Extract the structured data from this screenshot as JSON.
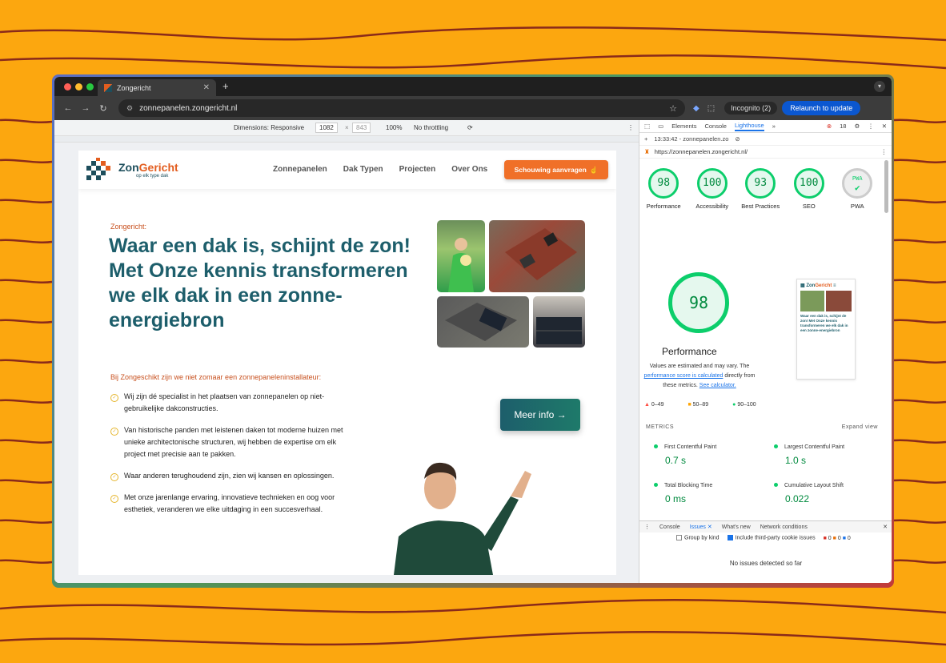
{
  "browser": {
    "tab_title": "Zongericht",
    "url": "zonnepanelen.zongericht.nl",
    "incognito_label": "Incognito (2)",
    "relaunch_label": "Relaunch to update"
  },
  "device_toolbar": {
    "dimensions_label": "Dimensions: Responsive",
    "width": "1082",
    "height": "843",
    "zoom": "100%",
    "throttling": "No throttling"
  },
  "site": {
    "logo_zon": "Zon",
    "logo_gericht": "Gericht",
    "logo_tagline": "op elk type dak",
    "nav": [
      "Zonnepanelen",
      "Dak Typen",
      "Projecten",
      "Over Ons"
    ],
    "cta_label": "Schouwing aanvragen",
    "kicker": "Zongericht:",
    "headline_1": "Waar een dak is, schijnt de zon!",
    "headline_2": "Met Onze kennis transformeren we elk dak in een zonne-energiebron",
    "intro": "Bij Zongeschikt zijn we niet zomaar een zonnepaneleninstallateur:",
    "bullets": [
      "Wij zijn dé specialist in het plaatsen van zonnepanelen op niet-gebruikelijke dakconstructies.",
      "Van historische panden met leistenen daken tot moderne huizen met unieke architectonische structuren, wij hebben de expertise om elk project met precisie aan te pakken.",
      "Waar anderen terughoudend zijn, zien wij kansen en oplossingen.",
      "Met onze jarenlange ervaring, innovatieve technieken en oog voor esthetiek, veranderen we elke uitdaging in een succesverhaal."
    ],
    "meer_info_label": "Meer info →"
  },
  "devtools": {
    "tabs": [
      "Elements",
      "Console",
      "Lighthouse"
    ],
    "error_count": "18",
    "report_time": "13:33:42 - zonnepanelen.zo",
    "report_url": "https://zonnepanelen.zongericht.nl/",
    "scores": [
      {
        "label": "Performance",
        "value": "98"
      },
      {
        "label": "Accessibility",
        "value": "100"
      },
      {
        "label": "Best Practices",
        "value": "93"
      },
      {
        "label": "SEO",
        "value": "100"
      },
      {
        "label": "PWA",
        "value": ""
      }
    ],
    "pwa_badge": "PWA",
    "big_score": "98",
    "big_label": "Performance",
    "note_1": "Values are estimated and may vary. The",
    "note_link_1": "performance score is calculated",
    "note_2": "directly from these metrics.",
    "note_link_2": "See calculator.",
    "legend": [
      "0–49",
      "50–89",
      "90–100"
    ],
    "metrics_title": "METRICS",
    "expand_label": "Expand view",
    "metrics": [
      {
        "name": "First Contentful Paint",
        "value": "0.7 s"
      },
      {
        "name": "Largest Contentful Paint",
        "value": "1.0 s"
      },
      {
        "name": "Total Blocking Time",
        "value": "0 ms"
      },
      {
        "name": "Cumulative Layout Shift",
        "value": "0.022"
      }
    ],
    "drawer_tabs": [
      "Console",
      "Issues",
      "What's new",
      "Network conditions"
    ],
    "group_by_kind": "Group by kind",
    "include_third_party": "Include third-party cookie issues",
    "issue_counts": [
      "0",
      "0",
      "0"
    ],
    "no_issues": "No issues detected so far"
  },
  "colors": {
    "background": "#fca70f",
    "brand_teal": "#1d5e6b",
    "brand_orange": "#f07028",
    "score_green": "#0cce6b"
  }
}
